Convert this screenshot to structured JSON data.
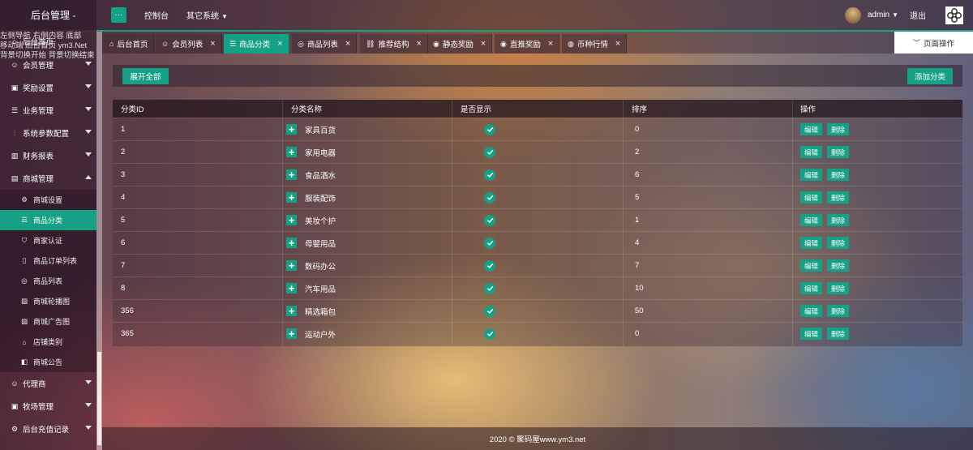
{
  "app": {
    "title": "后台管理 -",
    "menu_toggle": "···"
  },
  "topnav": {
    "items": [
      {
        "label": "控制台"
      },
      {
        "label": "其它系统"
      }
    ]
  },
  "user": {
    "name": "admin",
    "logout": "退出"
  },
  "marquee": [
    "左侧导航 右侧内容 底部",
    "移动端 后台首页 ym3.Net",
    "背景切换开始 背景切换结束"
  ],
  "sidebar": {
    "items": [
      {
        "label": "后台首页",
        "icon": "home-icon"
      },
      {
        "label": "会员管理",
        "icon": "user-icon"
      },
      {
        "label": "奖励设置",
        "icon": "gift-icon"
      },
      {
        "label": "业务管理",
        "icon": "list-icon"
      },
      {
        "label": "系统参数配置",
        "icon": "sliders-icon"
      },
      {
        "label": "财务报表",
        "icon": "chart-icon"
      },
      {
        "label": "商城管理",
        "icon": "cart-icon"
      }
    ],
    "mall_sub": [
      {
        "label": "商城设置",
        "icon": "gear-icon"
      },
      {
        "label": "商品分类",
        "icon": "list-icon"
      },
      {
        "label": "商家认证",
        "icon": "shield-icon"
      },
      {
        "label": "商品订单列表",
        "icon": "document-icon"
      },
      {
        "label": "商品列表",
        "icon": "circle-icon"
      },
      {
        "label": "商城轮播图",
        "icon": "image-icon"
      },
      {
        "label": "商城广告图",
        "icon": "image-icon"
      },
      {
        "label": "店铺类别",
        "icon": "store-icon"
      },
      {
        "label": "商城公告",
        "icon": "megaphone-icon"
      }
    ],
    "bottom": [
      {
        "label": "代理商",
        "icon": "user-icon"
      },
      {
        "label": "牧场管理",
        "icon": "gift-icon"
      },
      {
        "label": "后台充值记录",
        "icon": "gear-icon"
      }
    ]
  },
  "tabs": [
    {
      "label": "后台首页",
      "icon": "home-icon",
      "closable": false,
      "active": false
    },
    {
      "label": "会员列表",
      "icon": "users-icon",
      "closable": true,
      "active": false
    },
    {
      "label": "商品分类",
      "icon": "list-icon",
      "closable": true,
      "active": true
    },
    {
      "label": "商品列表",
      "icon": "circle-icon",
      "closable": true,
      "active": false
    },
    {
      "label": "推荐结构",
      "icon": "sitemap-icon",
      "closable": true,
      "active": false
    },
    {
      "label": "静态奖励",
      "icon": "dot-circle-icon",
      "closable": true,
      "active": false
    },
    {
      "label": "直推奖励",
      "icon": "dot-circle-icon",
      "closable": true,
      "active": false
    },
    {
      "label": "币种行情",
      "icon": "coin-icon",
      "closable": true,
      "active": false
    }
  ],
  "page_ops": "页面操作",
  "toolbar": {
    "expand_all": "展开全部",
    "add_category": "添加分类"
  },
  "table": {
    "headers": [
      "分类ID",
      "分类名称",
      "是否显示",
      "排序",
      "操作"
    ],
    "edit_label": "编辑",
    "delete_label": "删除",
    "rows": [
      {
        "id": "1",
        "name": "家具百货",
        "sort": "0"
      },
      {
        "id": "2",
        "name": "家用电器",
        "sort": "2"
      },
      {
        "id": "3",
        "name": "食品酒水",
        "sort": "6"
      },
      {
        "id": "4",
        "name": "服装配饰",
        "sort": "5"
      },
      {
        "id": "5",
        "name": "美妆个护",
        "sort": "1"
      },
      {
        "id": "6",
        "name": "母婴用品",
        "sort": "4"
      },
      {
        "id": "7",
        "name": "数码办公",
        "sort": "7"
      },
      {
        "id": "8",
        "name": "汽车用品",
        "sort": "10"
      },
      {
        "id": "356",
        "name": "精选箱包",
        "sort": "50"
      },
      {
        "id": "365",
        "name": "运动户外",
        "sort": "0"
      }
    ]
  },
  "footer": "2020 © 聚码屋www.ym3.net",
  "colors": {
    "accent": "#16a085"
  }
}
